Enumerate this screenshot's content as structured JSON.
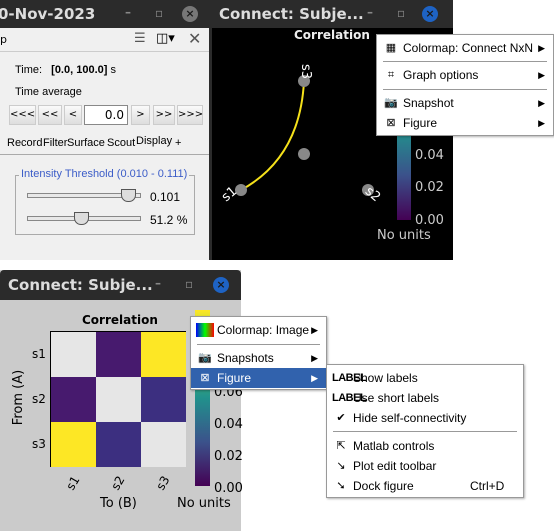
{
  "left_window": {
    "title": "0-Nov-2023",
    "toolbar_label": "p",
    "time_label": "Time:",
    "time_value": "[0.0, 100.0]",
    "time_unit": "s",
    "time_average": "Time average",
    "nav": [
      "<<<",
      "<<",
      "<",
      "0.0",
      ">",
      ">>",
      ">>>"
    ],
    "tabs": [
      "Record",
      "Filter",
      "Surface",
      "Scout",
      "Display",
      "+"
    ],
    "active_tab": "Display",
    "threshold": {
      "title": "Intensity Threshold (0.010 - 0.111)",
      "value": "0.101",
      "percent": "51.2 %",
      "slider1_fraction": 0.9,
      "slider2_fraction": 0.512
    }
  },
  "graph_window": {
    "title": "Connect: Subje...",
    "plot_title": "Correlation",
    "nodes": [
      "s1",
      "s2",
      "s3"
    ],
    "colorbar_ticks": [
      "0.04",
      "0.02",
      "0.00"
    ],
    "units": "No units",
    "link_color": "#f5e11a"
  },
  "graph_menu": {
    "items": [
      {
        "icon": "colormap-icon",
        "label": "Colormap: Connect NxN"
      },
      {
        "icon": "graph-icon",
        "label": "Graph options"
      },
      {
        "icon": "camera-icon",
        "label": "Snapshot"
      },
      {
        "icon": "figure-icon",
        "label": "Figure"
      }
    ]
  },
  "matrix_window": {
    "title": "Connect: Subje...",
    "plot_title": "Correlation",
    "ylabel": "From (A)",
    "xlabel": "To (B)",
    "rows": [
      "s1",
      "s2",
      "s3"
    ],
    "cols": [
      "s1",
      "s2",
      "s3"
    ],
    "colorbar_ticks": [
      "0.06",
      "0.04",
      "0.02",
      "0.00"
    ],
    "units": "No units"
  },
  "matrix_menu": {
    "items": [
      {
        "icon": "colormap-icon",
        "label": "Colormap: Image"
      },
      {
        "icon": "camera-icon",
        "label": "Snapshots"
      },
      {
        "icon": "figure-icon",
        "label": "Figure",
        "highlighted": true
      }
    ]
  },
  "figure_submenu": {
    "items": [
      {
        "icon": "label-icon",
        "icon_text": "LABEL",
        "label": "Show labels"
      },
      {
        "icon": "label-icon",
        "icon_text": "LABEL",
        "label": "Use short labels"
      },
      {
        "icon": "check-icon",
        "label": "Hide self-connectivity",
        "checked": true
      },
      {
        "icon": "cursor-icon",
        "label": "Matlab controls"
      },
      {
        "icon": "plot-edit-icon",
        "label": "Plot edit toolbar"
      },
      {
        "icon": "dock-icon",
        "label": "Dock figure",
        "shortcut": "Ctrl+D"
      }
    ]
  },
  "colors": {
    "highlight": "#3162ad",
    "matrix_diag": "#e6e6e6",
    "matrix_high": "#fde725",
    "matrix_low1": "#471a6e",
    "matrix_low2": "#3c2f80"
  }
}
